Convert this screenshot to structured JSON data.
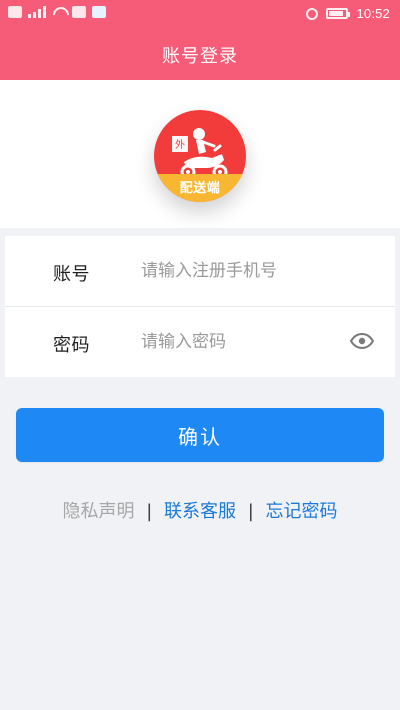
{
  "status_bar": {
    "time": "10:52",
    "icons": [
      "hd-icon",
      "cell-signal-icon",
      "wifi-icon",
      "app-icon",
      "app-icon",
      "alarm-icon",
      "battery-icon"
    ]
  },
  "header": {
    "title": "账号登录"
  },
  "logo": {
    "banner_text": "配送端",
    "badge_text": "外",
    "colors": {
      "circle": "#f23b3b",
      "banner": "#f7b733"
    }
  },
  "form": {
    "account": {
      "label": "账号",
      "placeholder": "请输入注册手机号"
    },
    "password": {
      "label": "密码",
      "placeholder": "请输入密码"
    }
  },
  "actions": {
    "confirm_label": "确认"
  },
  "footer_links": {
    "privacy": "隐私声明",
    "contact": "联系客服",
    "forgot": "忘记密码",
    "separator": "|"
  },
  "colors": {
    "topbar": "#f65c78",
    "primary": "#1e88f5",
    "link_blue": "#1b79d8",
    "muted": "#a7a7a7"
  }
}
